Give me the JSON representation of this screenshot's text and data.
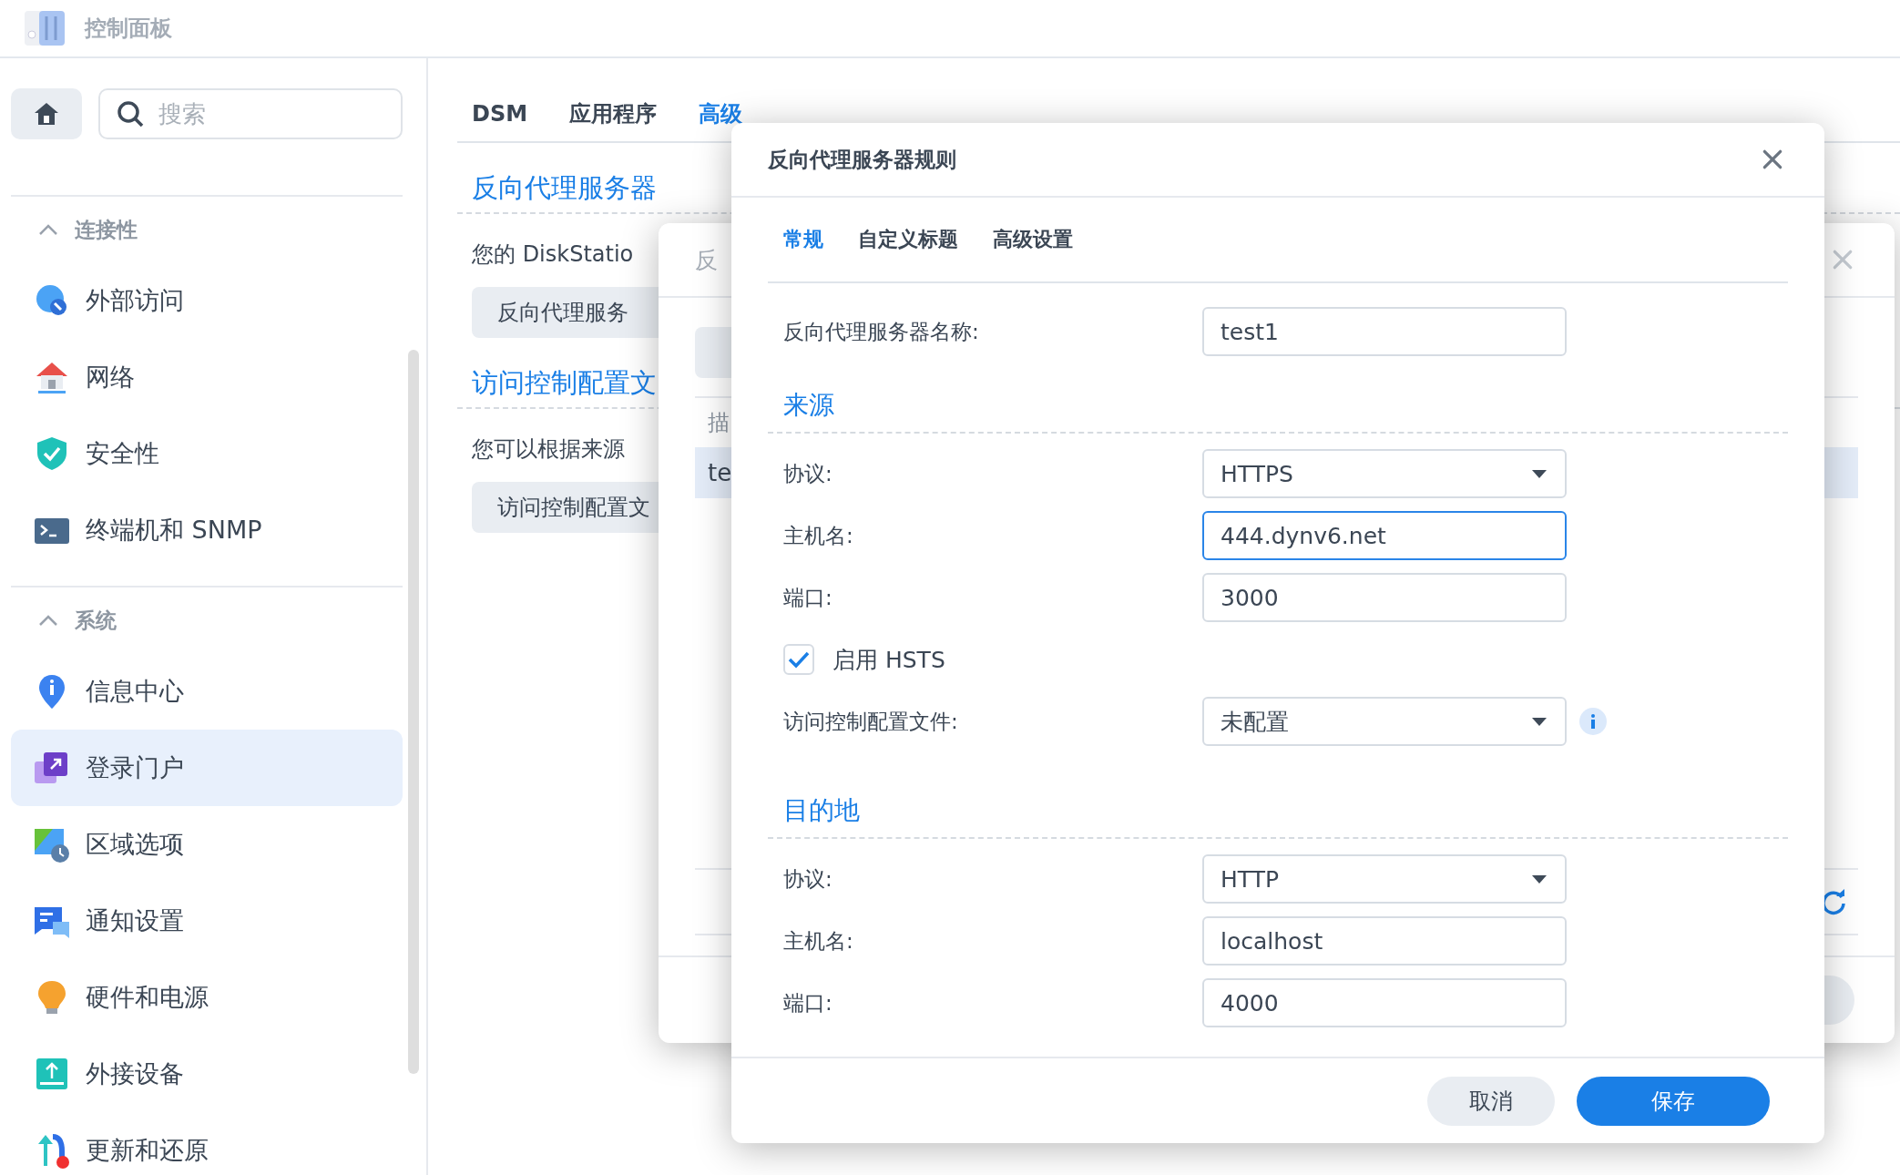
{
  "app": {
    "title": "控制面板"
  },
  "sidebar": {
    "search": {
      "placeholder": "搜索"
    },
    "groups": [
      {
        "title": "连接性",
        "expanded": true,
        "items": [
          {
            "label": "外部访问",
            "selected": false
          },
          {
            "label": "网络",
            "selected": false
          },
          {
            "label": "安全性",
            "selected": false
          },
          {
            "label": "终端机和 SNMP",
            "selected": false
          }
        ]
      },
      {
        "title": "系统",
        "expanded": true,
        "items": [
          {
            "label": "信息中心",
            "selected": false
          },
          {
            "label": "登录门户",
            "selected": true
          },
          {
            "label": "区域选项",
            "selected": false
          },
          {
            "label": "通知设置",
            "selected": false
          },
          {
            "label": "硬件和电源",
            "selected": false
          },
          {
            "label": "外接设备",
            "selected": false
          },
          {
            "label": "更新和还原",
            "selected": false
          }
        ]
      }
    ]
  },
  "main": {
    "tabs": [
      {
        "label": "DSM",
        "selected": false
      },
      {
        "label": "应用程序",
        "selected": false
      },
      {
        "label": "高级",
        "selected": true
      }
    ],
    "sections": [
      {
        "title": "反向代理服务器",
        "text": "您的 DiskStatio",
        "button": "反向代理服务"
      },
      {
        "title": "访问控制配置文",
        "text": "您可以根据来源",
        "button": "访问控制配置文"
      }
    ]
  },
  "list_dialog": {
    "title": "反",
    "column_1": "描",
    "rows": [
      {
        "cell": "te",
        "selected": true
      }
    ]
  },
  "rule_dialog": {
    "title": "反向代理服务器规则",
    "tabs": [
      {
        "label": "常规",
        "selected": true
      },
      {
        "label": "自定义标题",
        "selected": false
      },
      {
        "label": "高级设置",
        "selected": false
      }
    ],
    "fields": [
      {
        "kind": "text",
        "label": "反向代理服务器名称:",
        "value": "test1",
        "focused": false
      },
      {
        "kind": "heading",
        "label": "来源"
      },
      {
        "kind": "select",
        "label": "协议:",
        "value": "HTTPS",
        "info": false
      },
      {
        "kind": "text",
        "label": "主机名:",
        "value": "444.dynv6.net",
        "focused": true
      },
      {
        "kind": "text",
        "label": "端口:",
        "value": "3000",
        "focused": false
      },
      {
        "kind": "checkbox",
        "label": "启用 HSTS",
        "checked": true
      },
      {
        "kind": "select",
        "label": "访问控制配置文件:",
        "value": "未配置",
        "info": true
      },
      {
        "kind": "heading",
        "label": "目的地"
      },
      {
        "kind": "select",
        "label": "协议:",
        "value": "HTTP",
        "info": false
      },
      {
        "kind": "text",
        "label": "主机名:",
        "value": "localhost",
        "focused": false
      },
      {
        "kind": "text",
        "label": "端口:",
        "value": "4000",
        "focused": false
      }
    ],
    "buttons": [
      {
        "label": "取消",
        "kind": "secondary"
      },
      {
        "label": "保存",
        "kind": "primary"
      }
    ]
  }
}
